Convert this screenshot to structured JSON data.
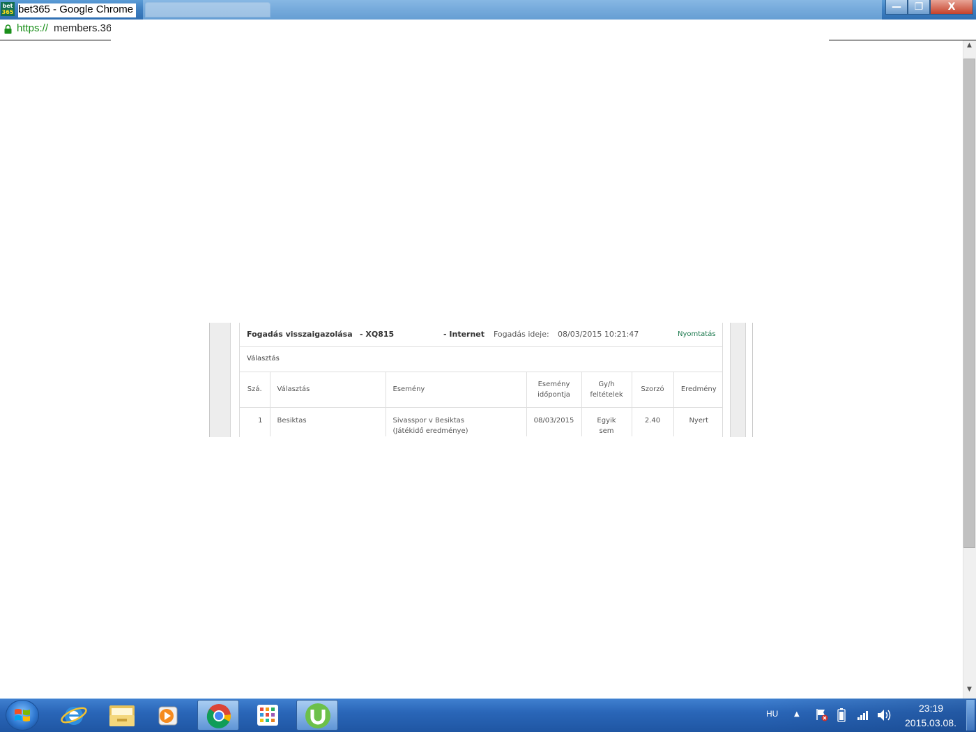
{
  "window": {
    "title": "bet365 - Google Chrome",
    "logo_top": "bet",
    "logo_bottom": "365",
    "controls": {
      "minimize": "—",
      "maximize": "❐",
      "close": "X"
    }
  },
  "addressbar": {
    "scheme": "https://",
    "host": "members.36"
  },
  "confirmation": {
    "title": "Fogadás visszaigazolása",
    "ref": "- XQ815",
    "channel": "- Internet",
    "bet_time_label": "Fogadás ideje:",
    "bet_time_value": "08/03/2015 10:21:47",
    "print_label": "Nyomtatás",
    "selection_heading": "Választás",
    "columns": {
      "no": "Szá.",
      "selection": "Választás",
      "event": "Esemény",
      "event_time_1": "Esemény",
      "event_time_2": "időpontja",
      "conditions_1": "Gy/h",
      "conditions_2": "feltételek",
      "odds": "Szorzó",
      "result": "Eredmény"
    },
    "rows": [
      {
        "no": "1",
        "selection": "Besiktas",
        "event_1": "Sivasspor v Besiktas",
        "event_2": "(Játékidő eredménye)",
        "event_time": "08/03/2015",
        "conditions_1": "Egyik",
        "conditions_2": "sem",
        "odds": "2.40",
        "result": "Nyert"
      }
    ]
  },
  "taskbar": {
    "language": "HU",
    "tray_arrow": "▲",
    "clock_time": "23:19",
    "clock_date": "2015.03.08.",
    "pinned": [
      "internet-explorer-icon",
      "file-explorer-icon",
      "media-player-icon",
      "chrome-icon",
      "apps-grid-icon",
      "utorrent-icon"
    ],
    "active_app": "chrome-icon"
  },
  "colors": {
    "accent_green": "#1d7a4f",
    "bet365_green": "#126e51",
    "bet365_yellow": "#ffdf1b",
    "taskbar_blue": "#2a66b8"
  }
}
